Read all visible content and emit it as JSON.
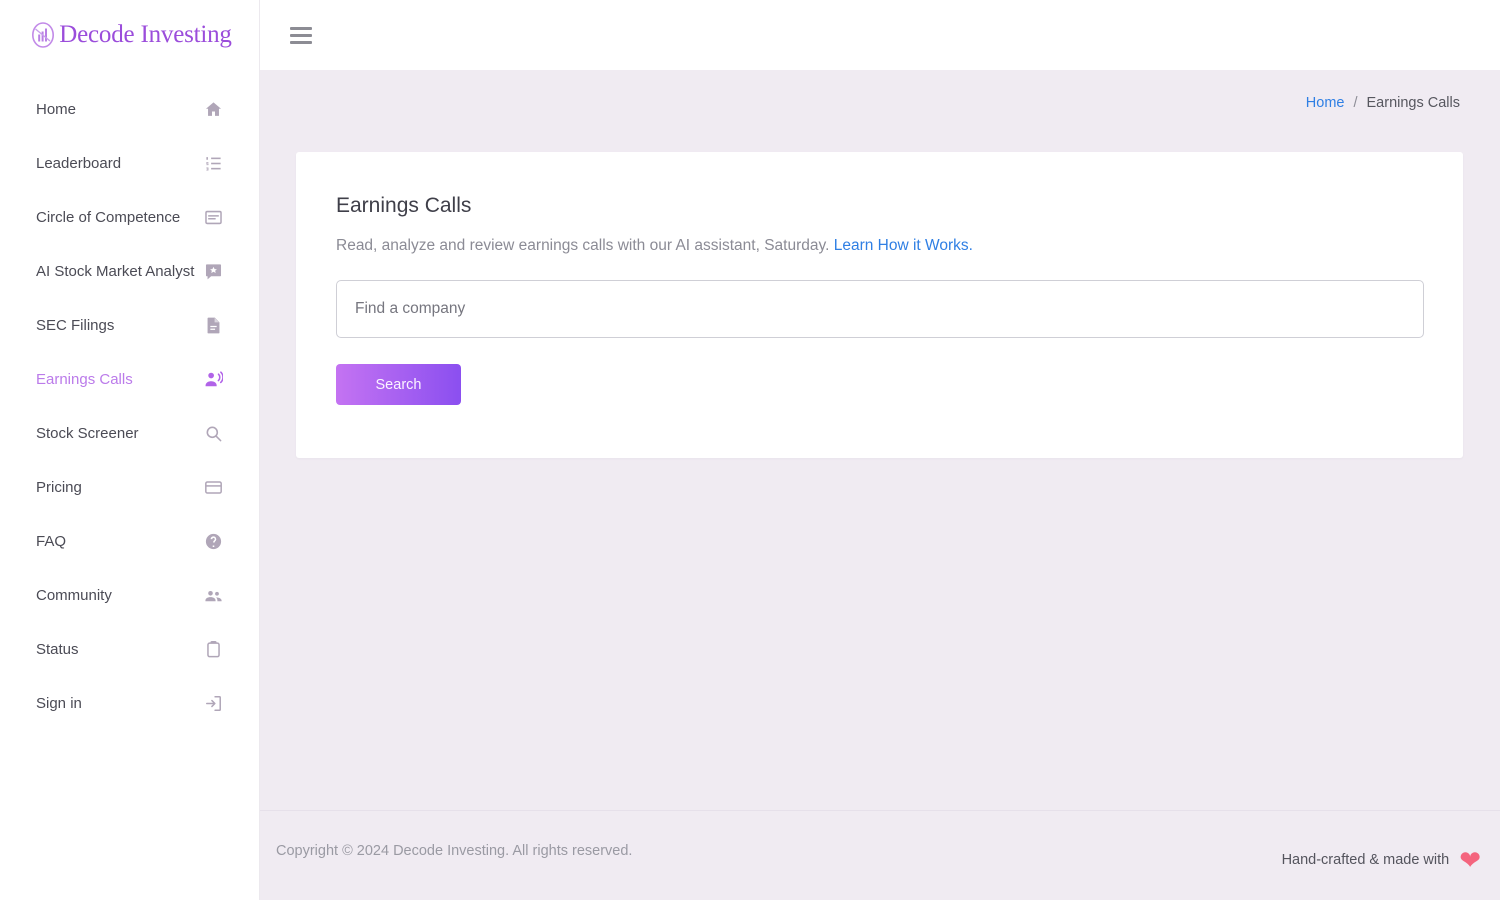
{
  "brand": {
    "name": "Decode Investing",
    "logo_icon": "chart-circle-logo-icon",
    "color": "#9b4ddb"
  },
  "topbar": {
    "menu_icon": "hamburger-menu-icon"
  },
  "sidebar": {
    "items": [
      {
        "label": "Home",
        "icon": "home-icon",
        "active": false
      },
      {
        "label": "Leaderboard",
        "icon": "list-ordered-icon",
        "active": false
      },
      {
        "label": "Circle of Competence",
        "icon": "web-asset-icon",
        "active": false
      },
      {
        "label": "AI Stock Market Analyst",
        "icon": "ai-chat-badge-icon",
        "active": false
      },
      {
        "label": "SEC Filings",
        "icon": "document-icon",
        "active": false
      },
      {
        "label": "Earnings Calls",
        "icon": "record-voice-over-icon",
        "active": true
      },
      {
        "label": "Stock Screener",
        "icon": "search-icon",
        "active": false
      },
      {
        "label": "Pricing",
        "icon": "credit-card-icon",
        "active": false
      },
      {
        "label": "FAQ",
        "icon": "help-circle-icon",
        "active": false
      },
      {
        "label": "Community",
        "icon": "people-group-icon",
        "active": false
      },
      {
        "label": "Status",
        "icon": "clipboard-icon",
        "active": false
      },
      {
        "label": "Sign in",
        "icon": "login-arrow-icon",
        "active": false
      }
    ],
    "active_color": "#bb7bea",
    "inactive_color": "#4b4b55"
  },
  "breadcrumb": {
    "home_label": "Home",
    "separator": "/",
    "current_label": "Earnings Calls",
    "link_color": "#2f7fe4"
  },
  "main": {
    "title": "Earnings Calls",
    "description_text": "Read, analyze and review earnings calls with our AI assistant, Saturday.",
    "learn_link_label": "Learn How it Works.",
    "search_placeholder": "Find a company",
    "search_value": "",
    "search_button_label": "Search",
    "button_gradient_from": "#c473f2",
    "button_gradient_to": "#8b4ff0"
  },
  "footer": {
    "copyright": "Copyright © 2024 Decode Investing. All rights reserved.",
    "made_with_text": "Hand-crafted & made with",
    "heart_icon": "heart-icon",
    "heart_color": "#f4647e"
  }
}
